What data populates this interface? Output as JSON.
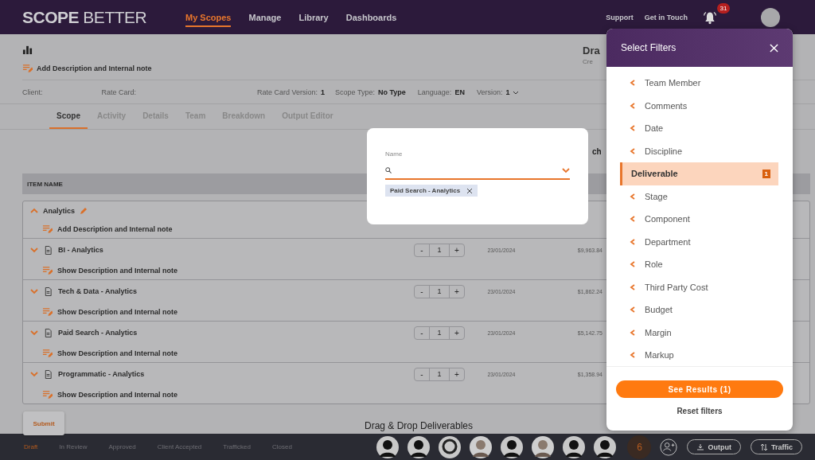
{
  "header": {
    "logo": "**SCOPE** BETTER",
    "nav": [
      {
        "label": "My Scopes",
        "selected": true
      },
      {
        "label": "Manage",
        "selected": false
      },
      {
        "label": "Library",
        "selected": false
      },
      {
        "label": "Dashboards",
        "selected": false
      }
    ],
    "links": [
      "Support",
      "Get in Touch"
    ],
    "notifications": "31"
  },
  "page": {
    "add_note": "Add Description and Internal note",
    "title": "Dra",
    "subtitle": "Cre",
    "info": [
      {
        "label": "Client:"
      },
      {
        "label": "Rate Card:"
      },
      {
        "label": "Rate Card Version:",
        "value": "1"
      },
      {
        "label": "Scope Type:",
        "value": "No Type"
      },
      {
        "label": "Language:",
        "value": "EN"
      },
      {
        "label": "Version:",
        "value": "1",
        "kind": "dropdown"
      }
    ],
    "tabs": [
      {
        "label": "Scope",
        "selected": true
      },
      {
        "label": "Activity",
        "selected": false
      },
      {
        "label": "Details",
        "selected": false
      },
      {
        "label": "Team",
        "selected": false
      },
      {
        "label": "Breakdown",
        "selected": false
      },
      {
        "label": "Output Editor",
        "selected": false
      }
    ],
    "search_label": "ch"
  },
  "table": {
    "header": "ITEM NAME",
    "group": {
      "name": "Analytics",
      "expanded": true,
      "note": "Add Description and Internal note"
    },
    "rows": [
      {
        "name": "BI - Analytics",
        "expanded": false,
        "decrement": "-",
        "increment": "+",
        "note": "Show Description and Internal note",
        "quantity": "1",
        "date": "23/01/2024",
        "amount": "$9,963.84"
      },
      {
        "name": "Tech & Data - Analytics",
        "expanded": false,
        "decrement": "-",
        "increment": "+",
        "note": "Show Description and Internal note",
        "quantity": "1",
        "date": "23/01/2024",
        "amount": "$1,862.24"
      },
      {
        "name": "Paid Search - Analytics",
        "expanded": false,
        "decrement": "-",
        "increment": "+",
        "note": "Show Description and Internal note",
        "quantity": "1",
        "date": "23/01/2024",
        "amount": "$5,142.75"
      },
      {
        "name": "Programmatic - Analytics",
        "expanded": false,
        "decrement": "-",
        "increment": "+",
        "note": "Show Description and Internal note",
        "quantity": "1",
        "date": "23/01/2024",
        "amount": "$1,358.94"
      }
    ]
  },
  "submit": "Submit",
  "drop_hint": "Drag & Drop Deliverables",
  "footer": {
    "statuses": [
      {
        "label": "Draft",
        "selected": true
      },
      {
        "label": "In Review",
        "selected": false
      },
      {
        "label": "Approved",
        "selected": false
      },
      {
        "label": "Client Accepted",
        "selected": false
      },
      {
        "label": "Trafficked",
        "selected": false
      },
      {
        "label": "Closed",
        "selected": false
      }
    ],
    "avatars": [
      {
        "kind": "dark"
      },
      {
        "kind": "dark"
      },
      {
        "kind": "ring"
      },
      {
        "kind": "light"
      },
      {
        "kind": "dark"
      },
      {
        "kind": "light"
      },
      {
        "kind": "dark"
      },
      {
        "kind": "dark"
      }
    ],
    "more": "6",
    "buttons": [
      {
        "label": "Output",
        "kind": "output"
      },
      {
        "label": "Traffic",
        "kind": "traffic"
      }
    ]
  },
  "popup": {
    "label": "Name",
    "tags": [
      "Paid Search - Analytics"
    ]
  },
  "filters": {
    "title": "Select Filters",
    "items": [
      {
        "label": "Team Member",
        "selected": false
      },
      {
        "label": "Comments",
        "selected": false
      },
      {
        "label": "Date",
        "selected": false
      },
      {
        "label": "Discipline",
        "selected": false
      },
      {
        "label": "Deliverable",
        "selected": true,
        "count": "1"
      },
      {
        "label": "Stage",
        "selected": false
      },
      {
        "label": "Component",
        "selected": false
      },
      {
        "label": "Department",
        "selected": false
      },
      {
        "label": "Role",
        "selected": false
      },
      {
        "label": "Third Party Cost",
        "selected": false
      },
      {
        "label": "Budget",
        "selected": false
      },
      {
        "label": "Margin",
        "selected": false
      },
      {
        "label": "Markup",
        "selected": false
      }
    ],
    "see_results": "See Results (1)",
    "reset": "Reset filters"
  }
}
